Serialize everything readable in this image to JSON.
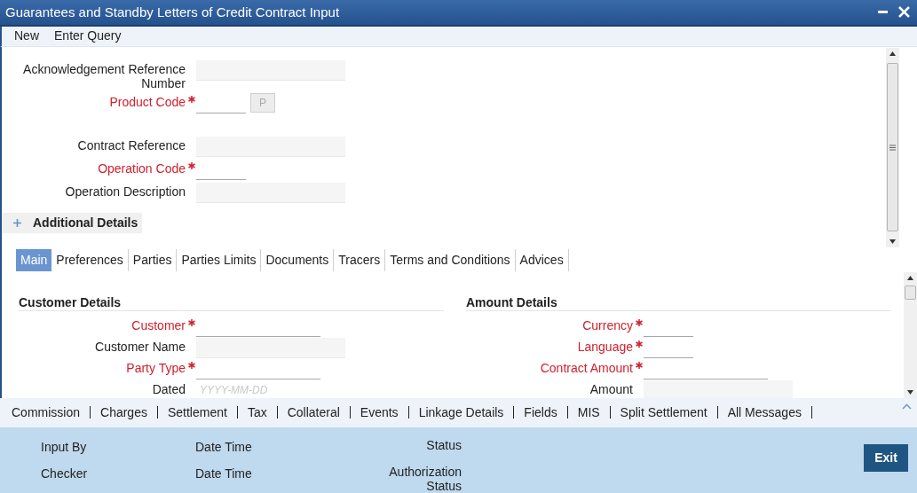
{
  "window": {
    "title": "Guarantees and Standby Letters of Credit Contract Input"
  },
  "toolbar": [
    "New",
    "Enter Query"
  ],
  "header_groups": [
    [
      {
        "label": "Acknowledgement Reference Number",
        "required": false,
        "kind": "display"
      },
      {
        "label": "Product Code",
        "required": true,
        "kind": "code",
        "button": "P"
      }
    ],
    [
      {
        "label": "Contract Reference",
        "required": false,
        "kind": "display"
      },
      {
        "label": "Operation Code",
        "required": true,
        "kind": "code"
      },
      {
        "label": "Operation Description",
        "required": false,
        "kind": "display"
      }
    ]
  ],
  "additional_details": {
    "label": "Additional Details",
    "expanded": false
  },
  "tabs": [
    {
      "label": "Main",
      "selected": true
    },
    {
      "label": "Preferences",
      "selected": false
    },
    {
      "label": "Parties",
      "selected": false
    },
    {
      "label": "Parties Limits",
      "selected": false
    },
    {
      "label": "Documents",
      "selected": false
    },
    {
      "label": "Tracers",
      "selected": false
    },
    {
      "label": "Terms and Conditions",
      "selected": false
    },
    {
      "label": "Advices",
      "selected": false
    }
  ],
  "sections": [
    {
      "title": "Customer Details",
      "fields": [
        {
          "label": "Customer",
          "required": true,
          "kind": "text"
        },
        {
          "label": "Customer Name",
          "required": false,
          "kind": "display"
        },
        {
          "label": "Party Type",
          "required": true,
          "kind": "text"
        },
        {
          "label": "Dated",
          "required": false,
          "kind": "date",
          "placeholder": "YYYY-MM-DD"
        }
      ]
    },
    {
      "title": "Amount Details",
      "fields": [
        {
          "label": "Currency",
          "required": true,
          "kind": "code"
        },
        {
          "label": "Language",
          "required": true,
          "kind": "code"
        },
        {
          "label": "Contract Amount",
          "required": true,
          "kind": "text"
        },
        {
          "label": "Amount",
          "required": false,
          "kind": "display"
        }
      ]
    }
  ],
  "bottom_links": [
    "Commission",
    "Charges",
    "Settlement",
    "Tax",
    "Collateral",
    "Events",
    "Linkage Details",
    "Fields",
    "MIS",
    "Split Settlement",
    "All Messages"
  ],
  "footer": {
    "rows": [
      [
        "Input By",
        "Date Time",
        "Status"
      ],
      [
        "Checker",
        "Date Time",
        "Authorization Status"
      ]
    ],
    "exit": "Exit"
  }
}
